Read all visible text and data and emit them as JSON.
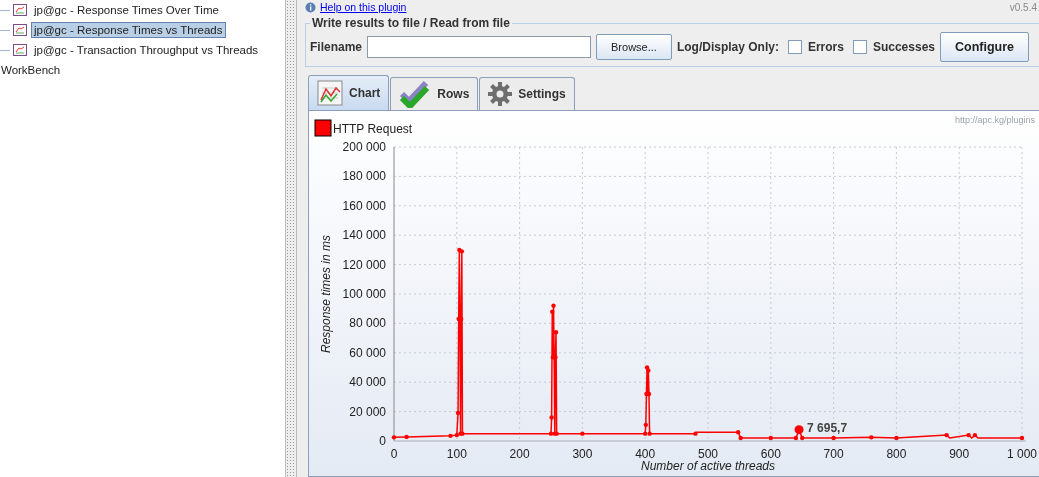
{
  "tree": {
    "items": [
      {
        "label": "jp@gc - Response Times Over Time",
        "selected": false
      },
      {
        "label": "jp@gc - Response Times vs Threads",
        "selected": true
      },
      {
        "label": "jp@gc - Transaction Throughput vs Threads",
        "selected": false
      }
    ],
    "root_label": "WorkBench"
  },
  "header": {
    "help_link": "Help on this plugin",
    "version": "v0.5.4"
  },
  "file_panel": {
    "title": "Write results to file / Read from file",
    "filename_label": "Filename",
    "browse_button": "Browse...",
    "log_label": "Log/Display Only:",
    "checkboxes": [
      {
        "label": "Errors",
        "checked": false
      },
      {
        "label": "Successes",
        "checked": false
      }
    ],
    "configure_button": "Configure"
  },
  "tabs": [
    {
      "label": "Chart",
      "kind": "chart",
      "selected": true
    },
    {
      "label": "Rows",
      "kind": "rows",
      "selected": false
    },
    {
      "label": "Settings",
      "kind": "settings",
      "selected": false
    }
  ],
  "chart": {
    "watermark": "http://apc.kg/plugins",
    "chart_data": {
      "type": "line",
      "grid": true,
      "xlabel": "Number of active threads",
      "ylabel": "Response times in ms",
      "x": [
        0,
        20,
        90,
        100,
        102,
        103,
        104,
        105,
        106,
        107,
        108,
        109,
        110,
        250,
        251,
        252,
        253,
        254,
        255,
        256,
        257,
        258,
        259,
        300,
        400,
        401,
        402,
        403,
        404,
        405,
        406,
        407,
        480,
        482,
        548,
        552,
        600,
        640,
        645,
        650,
        700,
        760,
        800,
        880,
        885,
        915,
        920,
        925,
        930,
        1000
      ],
      "series": [
        {
          "name": "HTTP Request",
          "color": "#ff0000",
          "values": [
            2500,
            2800,
            3500,
            4000,
            19000,
            83000,
            130000,
            83000,
            5000,
            83000,
            129000,
            5000,
            5000,
            5000,
            16000,
            88000,
            57000,
            92000,
            57000,
            5000,
            57000,
            74000,
            5000,
            5000,
            5000,
            11000,
            32000,
            50000,
            32000,
            48000,
            32000,
            5000,
            5000,
            6000,
            6000,
            2000,
            2000,
            2000,
            7700,
            2000,
            2000,
            2500,
            2000,
            4000,
            2000,
            4000,
            2000,
            4000,
            2000,
            2000
          ]
        }
      ],
      "xlim": [
        0,
        1000
      ],
      "ylim": [
        0,
        200000
      ],
      "xticks": [
        0,
        100,
        200,
        300,
        400,
        500,
        600,
        700,
        800,
        900,
        {
          "value": 1000,
          "label": "1 000"
        }
      ],
      "yticks": [
        0,
        {
          "value": 20000,
          "label": "20 000"
        },
        {
          "value": 40000,
          "label": "40 000"
        },
        {
          "value": 60000,
          "label": "60 000"
        },
        {
          "value": 80000,
          "label": "80 000"
        },
        {
          "value": 100000,
          "label": "100 000"
        },
        {
          "value": 120000,
          "label": "120 000"
        },
        {
          "value": 140000,
          "label": "140 000"
        },
        {
          "value": 160000,
          "label": "160 000"
        },
        {
          "value": 180000,
          "label": "180 000"
        },
        {
          "value": 200000,
          "label": "200 000"
        }
      ],
      "annotations": [
        {
          "x": 645,
          "y": 7695.7,
          "text": "7 695,7"
        }
      ]
    }
  }
}
